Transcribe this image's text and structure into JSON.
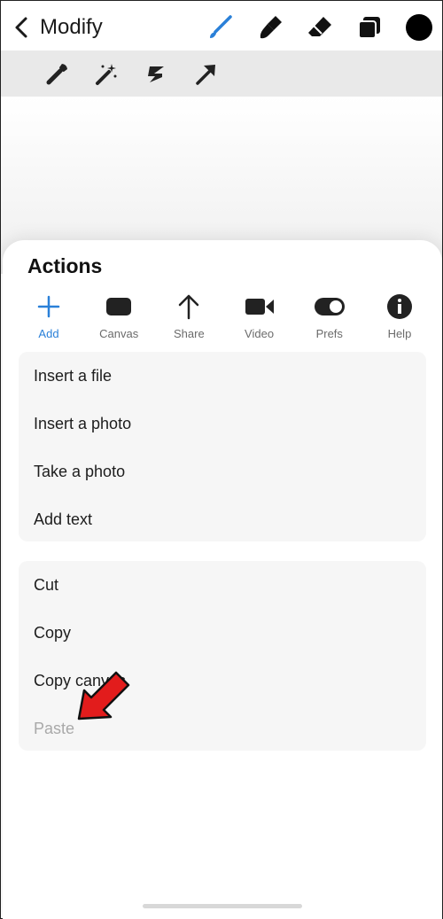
{
  "header": {
    "back_label": "Modify"
  },
  "colors": {
    "accent": "#2a80d8",
    "arrow": "#e21c1c",
    "panel_group": "#f6f6f6"
  },
  "toolbar": {
    "tools": [
      "brush-icon",
      "smudge-icon",
      "eraser-icon",
      "layers-icon",
      "color-icon"
    ]
  },
  "subtoolbar": {
    "tools": [
      "wrench-icon",
      "magic-wand-icon",
      "selection-icon",
      "transform-arrow-icon"
    ]
  },
  "actions": {
    "title": "Actions",
    "tabs": [
      {
        "label": "Add",
        "icon": "plus-icon",
        "active": true
      },
      {
        "label": "Canvas",
        "icon": "canvas-icon"
      },
      {
        "label": "Share",
        "icon": "share-icon"
      },
      {
        "label": "Video",
        "icon": "video-icon"
      },
      {
        "label": "Prefs",
        "icon": "toggle-icon"
      },
      {
        "label": "Help",
        "icon": "info-icon"
      }
    ],
    "group1": [
      "Insert a file",
      "Insert a photo",
      "Take a photo",
      "Add text"
    ],
    "group2": [
      "Cut",
      "Copy",
      "Copy canvas",
      "Paste"
    ]
  }
}
